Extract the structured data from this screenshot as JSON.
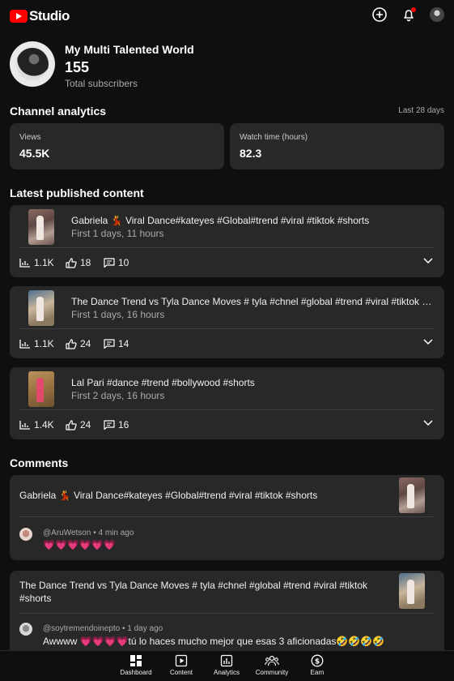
{
  "app": {
    "name": "Studio"
  },
  "header": {
    "icons": [
      "create-icon",
      "notifications-icon",
      "account-icon"
    ],
    "accent": "#ff0000"
  },
  "channel": {
    "name": "My Multi Talented World",
    "subscribers": "155",
    "subscribers_label": "Total subscribers"
  },
  "analytics": {
    "title": "Channel analytics",
    "range": "Last 28 days",
    "stats": [
      {
        "label": "Views",
        "value": "45.5K"
      },
      {
        "label": "Watch time (hours)",
        "value": "82.3"
      }
    ]
  },
  "latest": {
    "title": "Latest published content",
    "videos": [
      {
        "title": "Gabriela 💃 Viral Dance#kateyes #Global#trend #viral #tiktok #shorts",
        "published": "First 1 days, 11 hours",
        "views": "1.1K",
        "likes": "18",
        "comments": "10"
      },
      {
        "title": "The Dance Trend vs Tyla Dance Moves # tyla #chnel #global #trend #viral #tiktok #shorts",
        "published": "First 1 days, 16 hours",
        "views": "1.1K",
        "likes": "24",
        "comments": "14"
      },
      {
        "title": "Lal Pari #dance #trend #bollywood #shorts",
        "published": "First 2 days, 16 hours",
        "views": "1.4K",
        "likes": "24",
        "comments": "16"
      }
    ]
  },
  "comments": {
    "title": "Comments",
    "items": [
      {
        "video_title": "Gabriela 💃 Viral Dance#kateyes #Global#trend #viral #tiktok #shorts",
        "author": "@AruWetson",
        "time": "4 min ago",
        "text": "💗💗💗💗💗💗"
      },
      {
        "video_title": "The Dance Trend vs Tyla Dance Moves # tyla #chnel #global #trend #viral #tiktok #shorts",
        "author": "@soytremendoinepto",
        "time": "1 day ago",
        "text": "Awwww 💗💗💗💗tú lo haces mucho mejor que esas 3 aficionadas🤣🤣🤣🤣"
      }
    ]
  },
  "bottom_nav": [
    {
      "label": "Dashboard",
      "icon": "dashboard-icon"
    },
    {
      "label": "Content",
      "icon": "content-icon"
    },
    {
      "label": "Analytics",
      "icon": "analytics-icon"
    },
    {
      "label": "Community",
      "icon": "community-icon"
    },
    {
      "label": "Earn",
      "icon": "earn-icon"
    }
  ]
}
